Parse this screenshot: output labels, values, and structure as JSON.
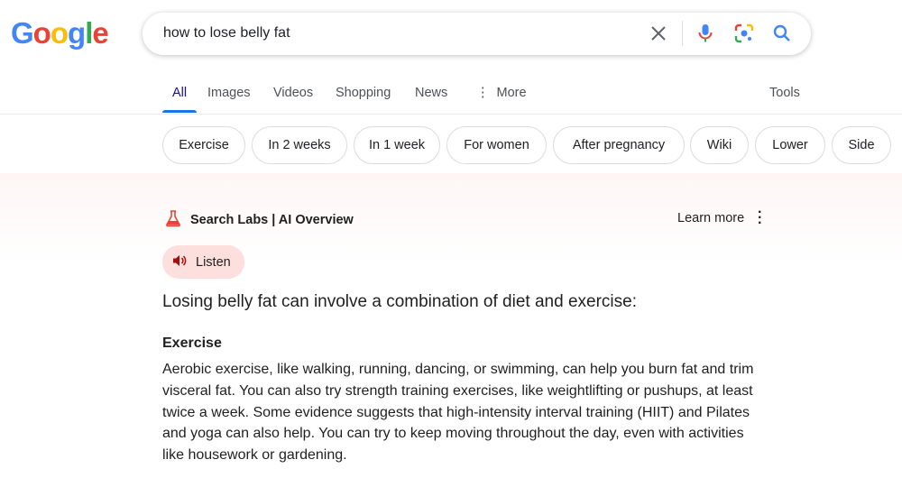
{
  "logo": {
    "letters": [
      "G",
      "o",
      "o",
      "g",
      "l",
      "e"
    ],
    "colors": [
      "#4285F4",
      "#EA4335",
      "#FBBC05",
      "#4285F4",
      "#34A853",
      "#EA4335"
    ]
  },
  "search": {
    "query": "how to lose belly fat",
    "icons": [
      "close-icon",
      "microphone-icon",
      "lens-icon",
      "search-icon"
    ]
  },
  "tabs": [
    {
      "label": "All",
      "active": true
    },
    {
      "label": "Images"
    },
    {
      "label": "Videos"
    },
    {
      "label": "Shopping"
    },
    {
      "label": "News"
    },
    {
      "label": "More"
    }
  ],
  "tools_label": "Tools",
  "chips": [
    "Exercise",
    "In 2 weeks",
    "In 1 week",
    "For women",
    "After pregnancy",
    "Wiki",
    "Lower",
    "Side"
  ],
  "ai_overview": {
    "title": "Search Labs | AI Overview",
    "learn_more": "Learn more",
    "listen_label": "Listen",
    "lead": "Losing belly fat can involve a combination of diet and exercise:",
    "section_heading": "Exercise",
    "section_text": "Aerobic exercise, like walking, running, dancing, or swimming, can help you burn fat and trim visceral fat. You can also try strength training exercises, like weightlifting or pushups, at least twice a week. Some evidence suggests that high-intensity interval training (HIIT) and Pilates and yoga can also help. You can try to keep moving throughout the day, even with activities like housework or gardening."
  },
  "colors": {
    "accent": "#1a73e8",
    "listen_bg": "#fddfdd",
    "flask": "#ea4335"
  }
}
